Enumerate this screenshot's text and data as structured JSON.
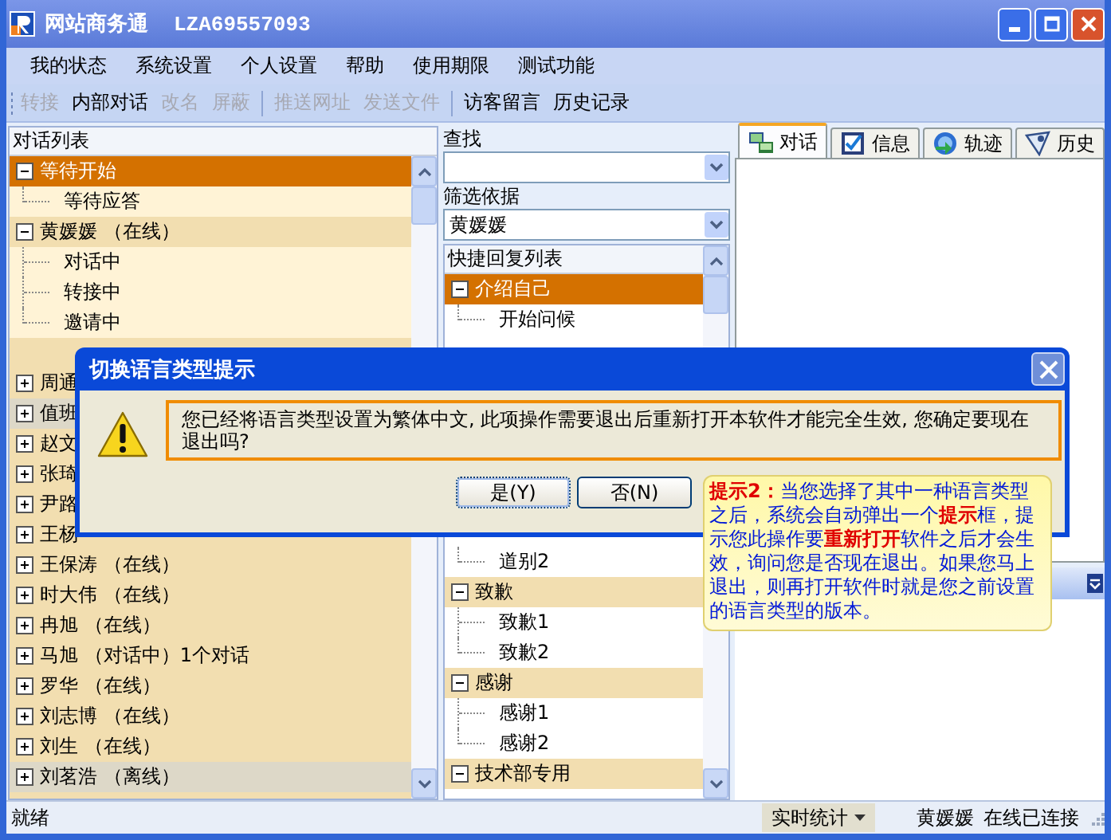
{
  "window": {
    "title": "网站商务通",
    "account": "LZA69557093"
  },
  "menu": [
    "我的状态",
    "系统设置",
    "个人设置",
    "帮助",
    "使用期限",
    "测试功能"
  ],
  "toolbar": [
    {
      "items": [
        {
          "label": "转接",
          "disabled": true
        },
        {
          "label": "内部对话",
          "disabled": false
        },
        {
          "label": "改名",
          "disabled": true
        },
        {
          "label": "屏蔽",
          "disabled": true
        }
      ]
    },
    {
      "items": [
        {
          "label": "推送网址",
          "disabled": true
        },
        {
          "label": "发送文件",
          "disabled": true
        }
      ]
    },
    {
      "items": [
        {
          "label": "访客留言",
          "disabled": false
        },
        {
          "label": "历史记录",
          "disabled": false
        }
      ]
    }
  ],
  "conversation_list": {
    "title": "对话列表",
    "groups": [
      {
        "label": "等待开始",
        "selected": true,
        "expanded": true,
        "muted": false,
        "children": [
          {
            "label": "等待应答"
          }
        ]
      },
      {
        "label": "黄媛媛 （在线）",
        "selected": false,
        "expanded": true,
        "muted": false,
        "children": [
          {
            "label": "对话中"
          },
          {
            "label": "转接中"
          },
          {
            "label": "邀请中"
          }
        ]
      },
      {
        "label": "周通",
        "selected": false,
        "expanded": false,
        "muted": false
      },
      {
        "label": "值班",
        "selected": false,
        "expanded": false,
        "muted": true
      },
      {
        "label": "赵文",
        "selected": false,
        "expanded": false,
        "muted": false
      },
      {
        "label": "张琦",
        "selected": false,
        "expanded": false,
        "muted": false
      },
      {
        "label": "尹路",
        "selected": false,
        "expanded": false,
        "muted": false
      },
      {
        "label": "王杨",
        "selected": false,
        "expanded": false,
        "muted": false
      },
      {
        "label": "王保涛 （在线）",
        "selected": false,
        "expanded": false,
        "muted": false
      },
      {
        "label": "时大伟 （在线）",
        "selected": false,
        "expanded": false,
        "muted": false
      },
      {
        "label": "冉旭 （在线）",
        "selected": false,
        "expanded": false,
        "muted": false
      },
      {
        "label": "马旭 （对话中）1个对话",
        "selected": false,
        "expanded": false,
        "muted": false
      },
      {
        "label": "罗华 （在线）",
        "selected": false,
        "expanded": false,
        "muted": false
      },
      {
        "label": "刘志博 （在线）",
        "selected": false,
        "expanded": false,
        "muted": false
      },
      {
        "label": "刘生 （在线）",
        "selected": false,
        "expanded": false,
        "muted": false
      },
      {
        "label": "刘茗浩 （离线）",
        "selected": false,
        "expanded": false,
        "muted": true
      }
    ]
  },
  "search": {
    "label": "查找"
  },
  "filter": {
    "label": "筛选依据",
    "value": "黄媛媛"
  },
  "quick_replies": {
    "title": "快捷回复列表",
    "groups": [
      {
        "label": "介绍自己",
        "selected": true,
        "expanded": true,
        "children": [
          {
            "label": "开始问候"
          }
        ]
      },
      {
        "children": [
          {
            "label": "道别2"
          }
        ]
      },
      {
        "label": "致歉",
        "selected": false,
        "expanded": true,
        "children": [
          {
            "label": "致歉1"
          },
          {
            "label": "致歉2"
          }
        ]
      },
      {
        "label": "感谢",
        "selected": false,
        "expanded": true,
        "children": [
          {
            "label": "感谢1"
          },
          {
            "label": "感谢2"
          }
        ]
      },
      {
        "label": "技术部专用",
        "selected": false,
        "expanded": true
      }
    ]
  },
  "tabs": [
    {
      "label": "对话",
      "selected": true
    },
    {
      "label": "信息",
      "selected": false
    },
    {
      "label": "轨迹",
      "selected": false
    },
    {
      "label": "历史",
      "selected": false
    }
  ],
  "dialog": {
    "title": "切换语言类型提示",
    "message": "您已经将语言类型设置为繁体中文, 此项操作需要退出后重新打开本软件才能完全生效, 您确定要现在退出吗?",
    "buttons": [
      {
        "label": "是(Y)",
        "default": true
      },
      {
        "label": "否(N)",
        "default": false
      }
    ]
  },
  "tooltip": {
    "text": "**提示2：**当您选择了其中一种语言类型之后，系统会自动弹出一个**提示**框，提示您此操作要**重新打开**软件之后才会生效，询问您是否现在退出。如果您马上退出，则再打开软件时就是您之前设置的语言类型的版本。"
  },
  "status_bar": {
    "message": "就绪",
    "stats_button": "实时统计",
    "user": "黄媛媛",
    "presence": "在线",
    "connection": "已连接"
  }
}
